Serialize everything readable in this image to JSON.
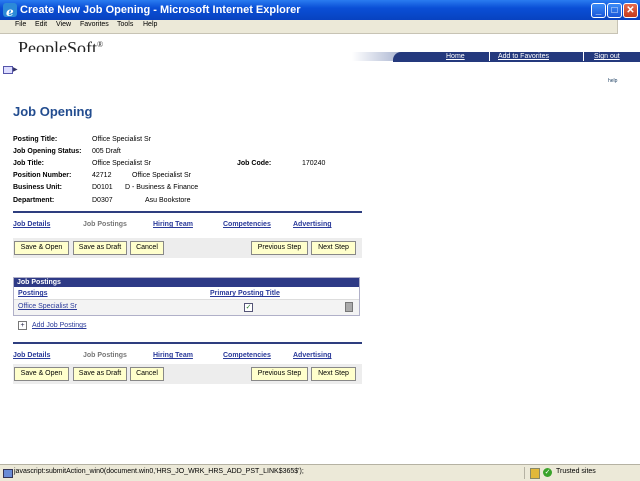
{
  "window": {
    "title": "Create New Job Opening - Microsoft Internet Explorer",
    "minimize": "_",
    "maximize": "□",
    "close": "✕"
  },
  "menu": [
    "File",
    "Edit",
    "View",
    "Favorites",
    "Tools",
    "Help"
  ],
  "brand": {
    "logo": "PeopleSoft",
    "mark": "®"
  },
  "nav": {
    "home": "Home",
    "add_favorites": "Add to Favorites",
    "sign_out": "Sign out",
    "help": "help"
  },
  "page": {
    "title": "Job Opening"
  },
  "fields": {
    "posting_title_label": "Posting Title:",
    "posting_title": "Office Specialist Sr",
    "status_label": "Job Opening Status:",
    "status": "005 Draft",
    "job_title_label": "Job Title:",
    "job_title": "Office Specialist Sr",
    "job_code_label": "Job Code:",
    "job_code": "170240",
    "position_label": "Position Number:",
    "position_number": "42712",
    "position_name": "Office Specialist Sr",
    "bu_label": "Business Unit:",
    "bu_code": "D0101",
    "bu_name": "D - Business & Finance",
    "dept_label": "Department:",
    "dept_code": "D0307",
    "dept_name": "Asu Bookstore"
  },
  "tabs": {
    "job_details": "Job Details",
    "job_postings": "Job Postings",
    "hiring_team": "Hiring Team",
    "competencies": "Competencies",
    "advertising": "Advertising"
  },
  "buttons": {
    "save_open": "Save & Open",
    "save_draft": "Save as Draft",
    "cancel": "Cancel",
    "previous": "Previous Step",
    "next": "Next Step"
  },
  "grid": {
    "title": "Job Postings",
    "col_postings": "Postings",
    "col_primary": "Primary Posting Title",
    "row_posting": "Office Specialist Sr",
    "row_primary_checked": true
  },
  "add_link": "Add Job Postings",
  "status": {
    "url": "javascript:submitAction_win0(document.win0,'HRS_JO_WRK_HRS_ADD_PST_LINK$365$');",
    "zone": "Trusted sites"
  }
}
